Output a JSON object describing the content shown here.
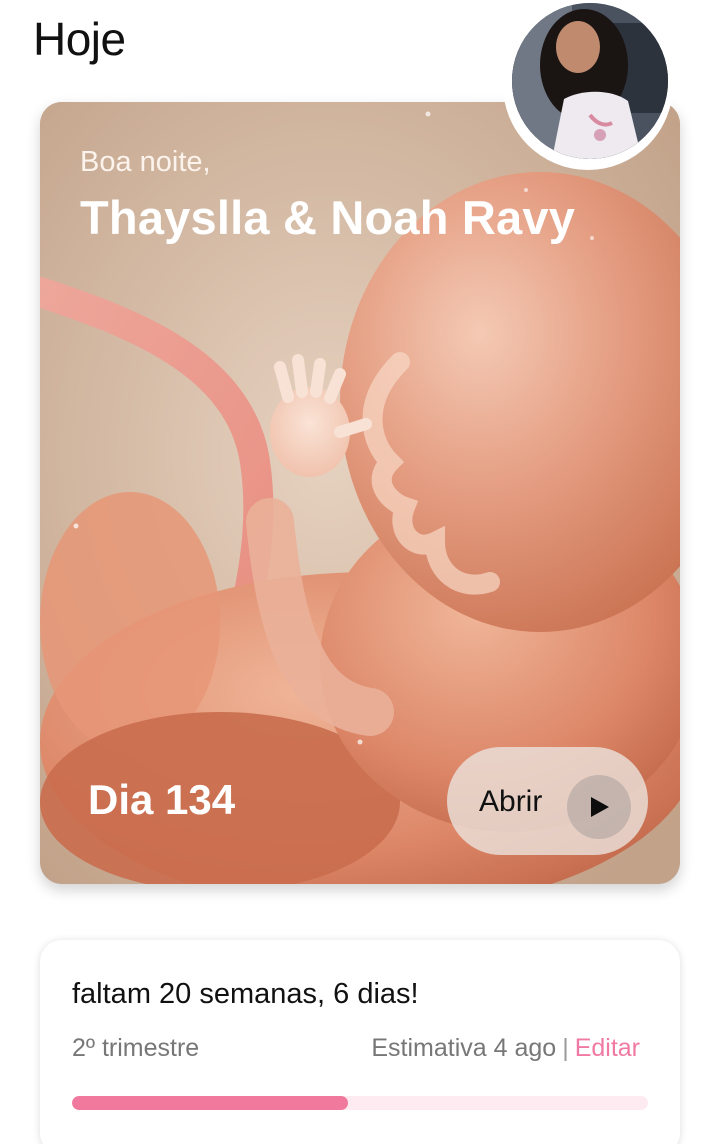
{
  "header": {
    "title": "Hoje"
  },
  "hero": {
    "greeting": "Boa noite,",
    "names": "Thayslla & Noah Ravy",
    "day_label": "Dia 134",
    "open_button_label": "Abrir",
    "open_icon": "play-icon",
    "image": "fetus-illustration"
  },
  "profile": {
    "avatar": "user-avatar-photo"
  },
  "progress": {
    "remaining_text": "faltam 20 semanas, 6 dias!",
    "trimester": "2º trimestre",
    "estimate": "Estimativa 4 ago",
    "separator": "|",
    "edit_label": "Editar",
    "fraction": 0.48,
    "fill_color": "#f2799e",
    "track_color": "#fdebf1",
    "accent_color": "#f07aa3"
  }
}
